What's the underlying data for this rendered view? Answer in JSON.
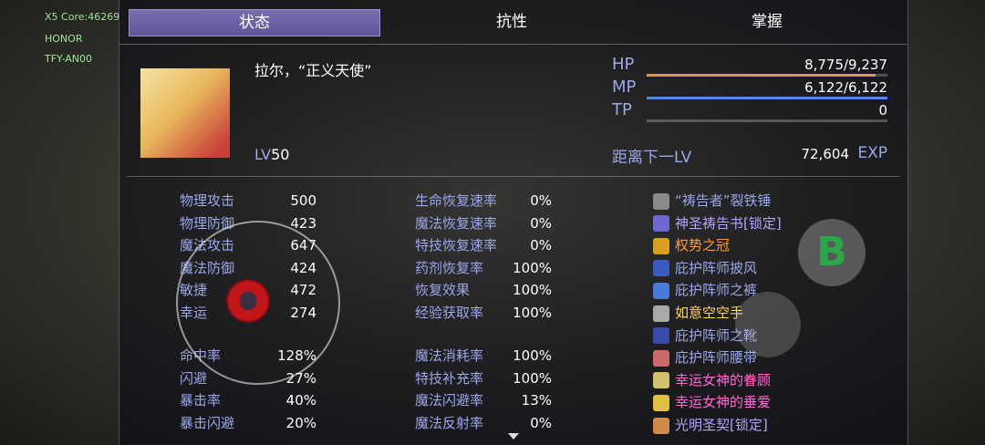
{
  "overlay": [
    "X5 Core:46269",
    "HONOR",
    "TFY-AN00"
  ],
  "tabs": [
    {
      "label": "状态",
      "active": true
    },
    {
      "label": "抗性",
      "active": false
    },
    {
      "label": "掌握",
      "active": false
    }
  ],
  "character": {
    "name": "拉尔，“正义天使”",
    "lv_label": "LV",
    "lv": "50"
  },
  "gauges": {
    "hp": {
      "label": "HP",
      "value": "8,775/9,237",
      "ratio": 0.95,
      "color": "#d49b4d"
    },
    "mp": {
      "label": "MP",
      "value": "6,122/6,122",
      "ratio": 1.0,
      "color": "#4d8de0"
    },
    "tp": {
      "label": "TP",
      "value": "0",
      "ratio": 0.0,
      "color": "#7fd16a"
    }
  },
  "exp": {
    "label": "距离下一LV",
    "value": "72,604",
    "unit": "EXP"
  },
  "base_stats": [
    {
      "k": "物理攻击",
      "v": "500"
    },
    {
      "k": "物理防御",
      "v": "423"
    },
    {
      "k": "魔法攻击",
      "v": "647"
    },
    {
      "k": "魔法防御",
      "v": "424"
    },
    {
      "k": "敏捷",
      "v": "472"
    },
    {
      "k": "幸运",
      "v": "274"
    }
  ],
  "combat_stats": [
    {
      "k": "命中率",
      "v": "128%"
    },
    {
      "k": "闪避",
      "v": "27%"
    },
    {
      "k": "暴击率",
      "v": "40%"
    },
    {
      "k": "暴击闪避",
      "v": "20%"
    }
  ],
  "rates_a": [
    {
      "k": "生命恢复速率",
      "v": "0%"
    },
    {
      "k": "魔法恢复速率",
      "v": "0%"
    },
    {
      "k": "特技恢复速率",
      "v": "0%"
    },
    {
      "k": "药剂恢复率",
      "v": "100%"
    },
    {
      "k": "恢复效果",
      "v": "100%"
    },
    {
      "k": "经验获取率",
      "v": "100%"
    }
  ],
  "rates_b": [
    {
      "k": "魔法消耗率",
      "v": "100%"
    },
    {
      "k": "特技补充率",
      "v": "100%"
    },
    {
      "k": "魔法闪避率",
      "v": "13%"
    },
    {
      "k": "魔法反射率",
      "v": "0%"
    }
  ],
  "equipment": [
    {
      "name": "“祷告者”裂铁锤",
      "color": "#9aa7e8",
      "icon": "hammer-icon",
      "icolor": "#8a8a8a"
    },
    {
      "name": "神圣祷告书[锁定]",
      "color": "#b7a2ff",
      "icon": "book-icon",
      "icolor": "#6a6ad0"
    },
    {
      "name": "权势之冠",
      "color": "#ff9a3d",
      "icon": "crown-icon",
      "icolor": "#d8a020"
    },
    {
      "name": "庇护阵师披风",
      "color": "#9aa7e8",
      "icon": "cape-icon",
      "icolor": "#3a5ac0"
    },
    {
      "name": "庇护阵师之裤",
      "color": "#9aa7e8",
      "icon": "pants-icon",
      "icolor": "#4a7ad8"
    },
    {
      "name": "如意空空手",
      "color": "#ffd75a",
      "icon": "glove-icon",
      "icolor": "#aaaaaa"
    },
    {
      "name": "庇护阵师之靴",
      "color": "#9aa7e8",
      "icon": "boots-icon",
      "icolor": "#3a4aa8"
    },
    {
      "name": "庇护阵师腰带",
      "color": "#9aa7e8",
      "icon": "belt-icon",
      "icolor": "#c86a6a"
    },
    {
      "name": "幸运女神的眷顾",
      "color": "#ff6ad5",
      "icon": "amulet-icon",
      "icolor": "#d0c070"
    },
    {
      "name": "幸运女神的垂爱",
      "color": "#ff6ad5",
      "icon": "amulet-icon",
      "icolor": "#e0c040"
    },
    {
      "name": "光明圣契[锁定]",
      "color": "#b7a2ff",
      "icon": "scroll-icon",
      "icolor": "#d08a4a"
    }
  ],
  "buttons": {
    "b": "B"
  }
}
